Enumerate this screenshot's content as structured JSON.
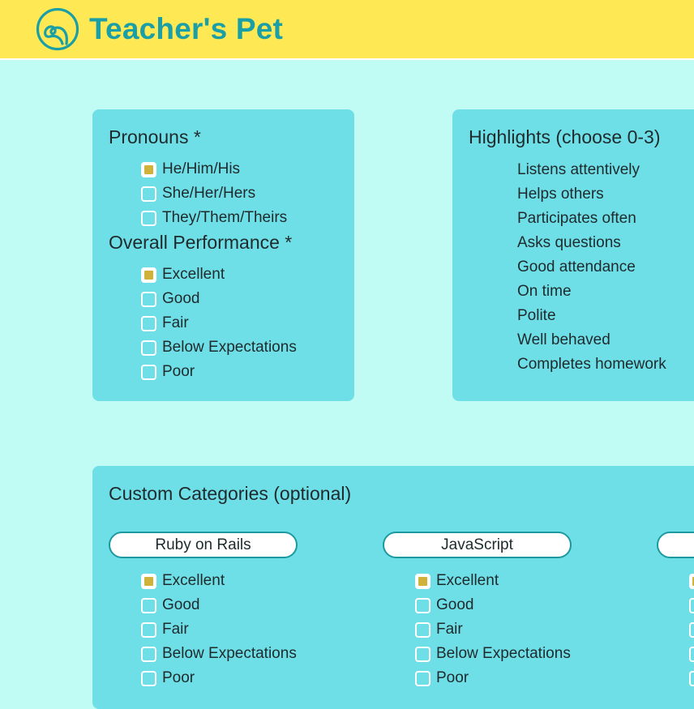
{
  "app": {
    "title": "Teacher's Pet",
    "logo_icon": "swirl-logo-icon"
  },
  "colors": {
    "header": "#fee853",
    "page_bg": "#c0fbf4",
    "card_bg": "#6fdfe7",
    "accent": "#1a9fa7",
    "check_fill": "#d0b13a"
  },
  "pronouns": {
    "heading": "Pronouns *",
    "options": [
      {
        "label": "He/Him/His",
        "checked": true
      },
      {
        "label": "She/Her/Hers",
        "checked": false
      },
      {
        "label": "They/Them/Theirs",
        "checked": false
      }
    ]
  },
  "performance": {
    "heading": "Overall Performance *",
    "options": [
      {
        "label": "Excellent",
        "checked": true
      },
      {
        "label": "Good",
        "checked": false
      },
      {
        "label": "Fair",
        "checked": false
      },
      {
        "label": "Below Expectations",
        "checked": false
      },
      {
        "label": "Poor",
        "checked": false
      }
    ]
  },
  "highlights": {
    "heading": "Highlights (choose 0-3)",
    "items": [
      "Listens attentively",
      "Helps others",
      "Participates often",
      "Asks questions",
      "Good attendance",
      "On time",
      "Polite",
      "Well behaved",
      "Completes homework"
    ]
  },
  "custom": {
    "heading": "Custom Categories (optional)",
    "categories": [
      {
        "name": "Ruby on Rails",
        "options": [
          {
            "label": "Excellent",
            "checked": true
          },
          {
            "label": "Good",
            "checked": false
          },
          {
            "label": "Fair",
            "checked": false
          },
          {
            "label": "Below Expectations",
            "checked": false
          },
          {
            "label": "Poor",
            "checked": false
          }
        ]
      },
      {
        "name": "JavaScript",
        "options": [
          {
            "label": "Excellent",
            "checked": true
          },
          {
            "label": "Good",
            "checked": false
          },
          {
            "label": "Fair",
            "checked": false
          },
          {
            "label": "Below Expectations",
            "checked": false
          },
          {
            "label": "Poor",
            "checked": false
          }
        ]
      },
      {
        "name": "",
        "options": [
          {
            "label": "",
            "checked": true
          },
          {
            "label": "",
            "checked": false
          },
          {
            "label": "",
            "checked": false
          },
          {
            "label": "",
            "checked": false
          },
          {
            "label": "",
            "checked": false
          }
        ]
      }
    ]
  }
}
